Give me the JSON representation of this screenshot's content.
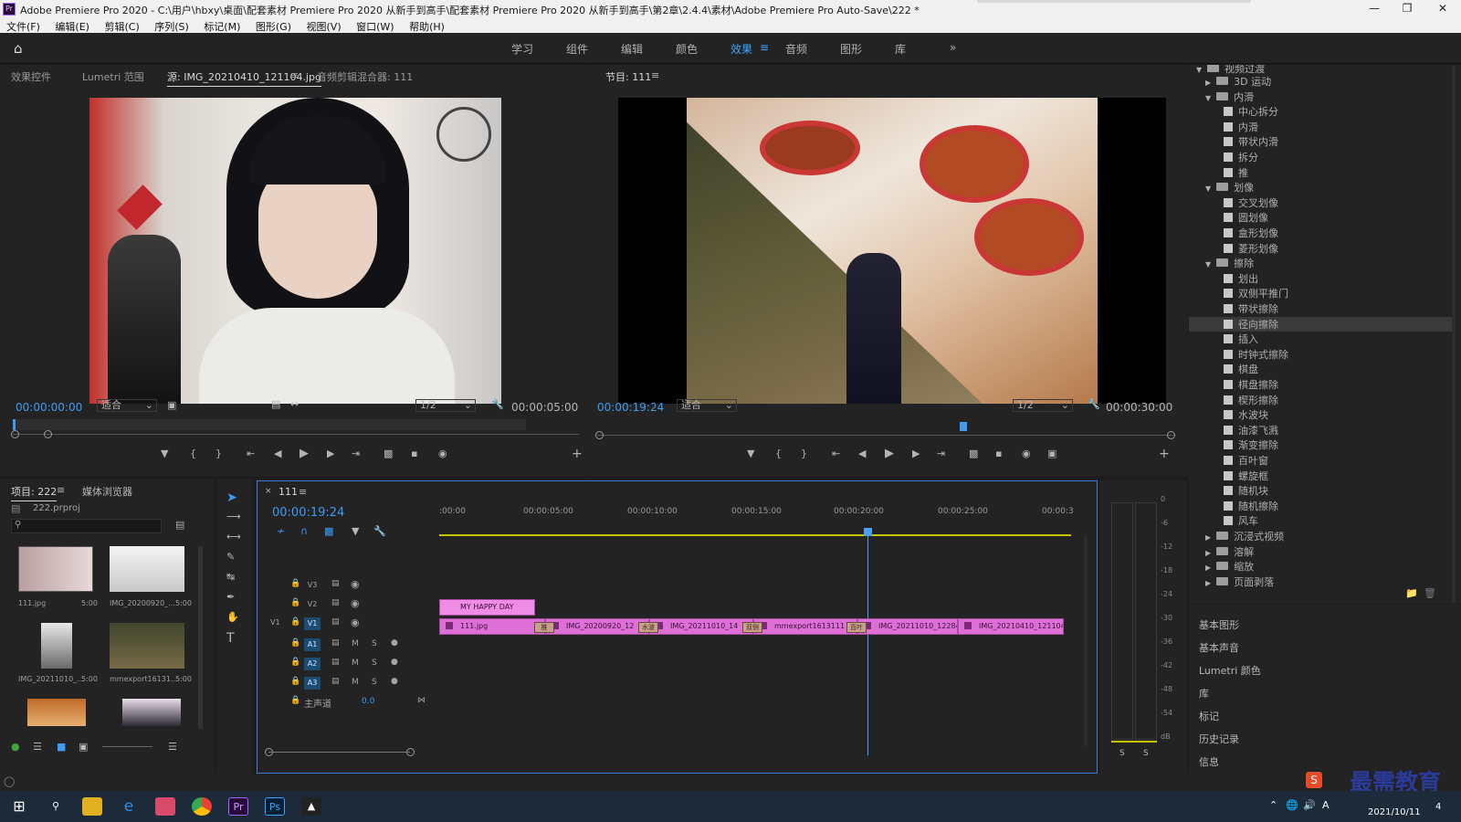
{
  "window": {
    "title": "Adobe Premiere Pro 2020 - C:\\用户\\hbxy\\桌面\\配套素材 Premiere Pro 2020 从新手到高手\\配套素材 Premiere Pro 2020 从新手到高手\\第2章\\2.4.4\\素材\\Adobe Premiere Pro Auto-Save\\222 *",
    "app_icon": "Pr"
  },
  "menu": [
    "文件(F)",
    "编辑(E)",
    "剪辑(C)",
    "序列(S)",
    "标记(M)",
    "图形(G)",
    "视图(V)",
    "窗口(W)",
    "帮助(H)"
  ],
  "workspaces": [
    "学习",
    "组件",
    "编辑",
    "颜色",
    "效果",
    "音频",
    "图形",
    "库"
  ],
  "workspace_active": "效果",
  "workspace_more": "»",
  "source_panel": {
    "tabs": [
      "效果控件",
      "Lumetri 范围",
      "源: IMG_20210410_121104.jpg",
      "音频剪辑混合器: 111"
    ],
    "timecode_in": "00:00:00:00",
    "fit": "适合",
    "resolution": "1/2",
    "duration": "00:00:05:00"
  },
  "program_panel": {
    "title": "节目: 111",
    "timecode": "00:00:19:24",
    "fit": "适合",
    "resolution": "1/2",
    "duration": "00:00:30:00"
  },
  "project_panel": {
    "tabs": [
      "项目: 222",
      "媒体浏览器"
    ],
    "file": "222.prproj",
    "items": [
      {
        "name": "111.jpg",
        "duration": "5:00"
      },
      {
        "name": "IMG_20200920_...",
        "duration": "5:00"
      },
      {
        "name": "IMG_20211010_...",
        "duration": "5:00"
      },
      {
        "name": "mmexport16131...",
        "duration": "5:00"
      }
    ]
  },
  "timeline": {
    "tab": "111",
    "timecode": "00:00:19:24",
    "ruler": [
      ":00:00",
      "00:00:05:00",
      "00:00:10:00",
      "00:00:15:00",
      "00:00:20:00",
      "00:00:25:00",
      "00:00:3"
    ],
    "tracks": [
      {
        "label": "V3",
        "type": "video"
      },
      {
        "label": "V2",
        "type": "video"
      },
      {
        "label": "V1",
        "type": "video"
      },
      {
        "label": "A1",
        "type": "audio"
      },
      {
        "label": "A2",
        "type": "audio"
      },
      {
        "label": "A3",
        "type": "audio"
      }
    ],
    "master": {
      "label": "主声道",
      "value": "0.0"
    },
    "v1_source_label": "V1",
    "v2_clip": "MY HAPPY DAY",
    "v1_clips": [
      "111.jpg",
      "IMG_20200920_12",
      "IMG_20211010_14",
      "mmexport1613111",
      "IMG_20211010_12284",
      "IMG_20210410_121104.jp"
    ],
    "transitions": [
      "推",
      "水波",
      "双侧",
      "百叶"
    ],
    "track_toggles": {
      "mute": "M",
      "solo": "S"
    }
  },
  "audio_meter": {
    "scale": [
      "0",
      "-6",
      "-12",
      "-18",
      "-24",
      "-30",
      "-36",
      "-42",
      "-48",
      "-54",
      "dB"
    ],
    "solo_left": "S",
    "solo_right": "S"
  },
  "effects_panel": {
    "tree": [
      {
        "kind": "folder",
        "label": "视频过渡",
        "level": 0,
        "partial": true
      },
      {
        "kind": "folder",
        "label": "3D 运动",
        "level": 1,
        "open": false
      },
      {
        "kind": "folder",
        "label": "内滑",
        "level": 1,
        "open": true
      },
      {
        "kind": "item",
        "label": "中心拆分"
      },
      {
        "kind": "item",
        "label": "内滑"
      },
      {
        "kind": "item",
        "label": "带状内滑"
      },
      {
        "kind": "item",
        "label": "拆分"
      },
      {
        "kind": "item",
        "label": "推"
      },
      {
        "kind": "folder",
        "label": "划像",
        "level": 1,
        "open": true
      },
      {
        "kind": "item",
        "label": "交叉划像"
      },
      {
        "kind": "item",
        "label": "圆划像"
      },
      {
        "kind": "item",
        "label": "盒形划像"
      },
      {
        "kind": "item",
        "label": "菱形划像"
      },
      {
        "kind": "folder",
        "label": "擦除",
        "level": 1,
        "open": true
      },
      {
        "kind": "item",
        "label": "划出"
      },
      {
        "kind": "item",
        "label": "双侧平推门"
      },
      {
        "kind": "item",
        "label": "带状擦除"
      },
      {
        "kind": "item",
        "label": "径向擦除",
        "selected": true
      },
      {
        "kind": "item",
        "label": "插入"
      },
      {
        "kind": "item",
        "label": "时钟式擦除"
      },
      {
        "kind": "item",
        "label": "棋盘"
      },
      {
        "kind": "item",
        "label": "棋盘擦除"
      },
      {
        "kind": "item",
        "label": "楔形擦除"
      },
      {
        "kind": "item",
        "label": "水波块"
      },
      {
        "kind": "item",
        "label": "油漆飞溅"
      },
      {
        "kind": "item",
        "label": "渐变擦除"
      },
      {
        "kind": "item",
        "label": "百叶窗"
      },
      {
        "kind": "item",
        "label": "螺旋框"
      },
      {
        "kind": "item",
        "label": "随机块"
      },
      {
        "kind": "item",
        "label": "随机擦除"
      },
      {
        "kind": "item",
        "label": "风车"
      },
      {
        "kind": "folder",
        "label": "沉浸式视频",
        "level": 1,
        "open": false
      },
      {
        "kind": "folder",
        "label": "溶解",
        "level": 1,
        "open": false
      },
      {
        "kind": "folder",
        "label": "缩放",
        "level": 1,
        "open": false
      },
      {
        "kind": "folder",
        "label": "页面剥落",
        "level": 1,
        "open": false
      }
    ],
    "side_panels": [
      "基本图形",
      "基本声音",
      "Lumetri 颜色",
      "库",
      "标记",
      "历史记录",
      "信息"
    ]
  },
  "watermark": {
    "text": "最需教育",
    "badge": "S"
  },
  "taskbar": {
    "time": "2021/10/11",
    "notification_count": "4"
  },
  "colors": {
    "accent": "#3d9bf3",
    "clip_pink": "#de6fd7",
    "playhead": "#4a9ff0",
    "timeline_yellow": "#c8c400"
  }
}
